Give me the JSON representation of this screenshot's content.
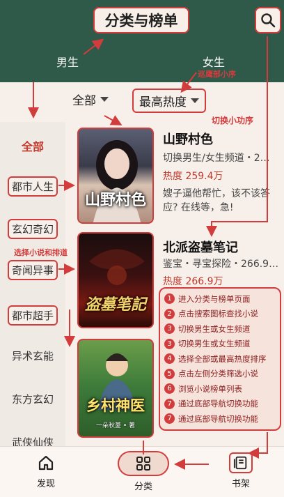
{
  "header": {
    "title": "分类与榜单",
    "search_icon": "search-icon",
    "gender_tabs": [
      "男生",
      "女生"
    ],
    "annotation_miniapp": "巡鹰部小序"
  },
  "filters": {
    "scope": "全部",
    "sort": "最高热度",
    "annotation": "切换小功序"
  },
  "sidebar": {
    "items": [
      "全部",
      "都市人生",
      "玄幻奇幻",
      "奇闻异事",
      "都市超手",
      "异术玄能",
      "东方玄幻",
      "武侠仙侠"
    ],
    "annotation": "选择小说和排道"
  },
  "books": [
    {
      "title": "山野村色",
      "cover_text": "山野村色",
      "meta": "切换男生/女生频道・2…",
      "heat": "热度 259.4万",
      "desc": "嫂子逼他帮忙，该不该答应? 在线等，急!"
    },
    {
      "title": "北派盗墓笔记",
      "cover_text": "盗墓笔記",
      "meta": "鉴宝・寻宝探险・266.9…",
      "heat": "热度 266.9万",
      "desc": ""
    },
    {
      "title": "",
      "cover_text": "乡村神医",
      "cover_author": "一朵秋菱 • 著",
      "meta": "",
      "heat": "",
      "desc": ""
    }
  ],
  "steps": [
    "进入分类与榜单页面",
    "点击搜索图标查找小说",
    "切换男生或女生频道",
    "切换男生或女生频道",
    "选择全部或最高热度排序",
    "点击左侧分类筛选小说",
    "浏览小说榜单列表",
    "通过底部导航切换功能",
    "通过底部导航切换功能"
  ],
  "tabbar": {
    "items": [
      {
        "label": "发现",
        "icon": "home-icon"
      },
      {
        "label": "分类",
        "icon": "grid-icon"
      },
      {
        "label": "书架",
        "icon": "book-icon"
      }
    ]
  },
  "colors": {
    "header_bg": "#2f5a4a",
    "accent": "#d23c3c",
    "heat": "#c0392b",
    "page_bg": "#f7efe9"
  }
}
